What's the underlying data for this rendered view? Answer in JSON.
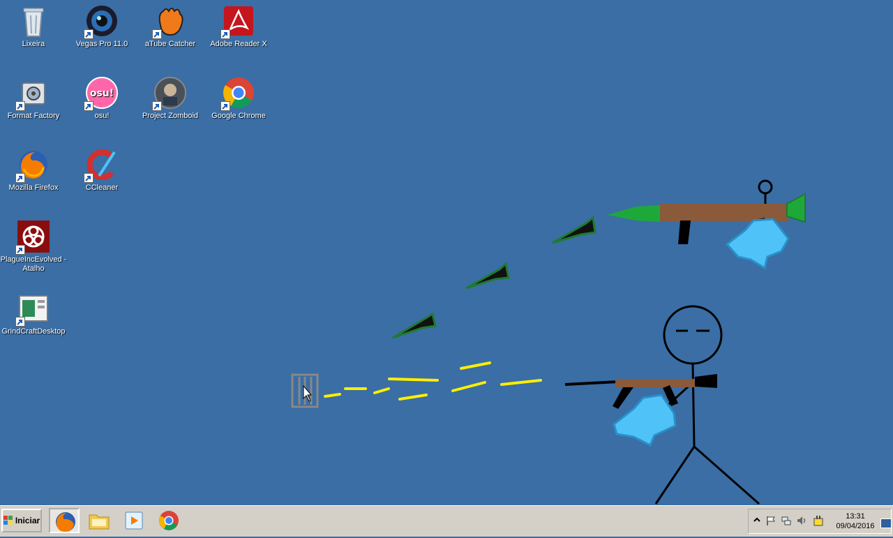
{
  "desktop": {
    "icons": [
      {
        "label": "Lixeira"
      },
      {
        "label": "Vegas Pro 11.0"
      },
      {
        "label": "aTube Catcher"
      },
      {
        "label": "Adobe Reader X"
      },
      {
        "label": "Format Factory"
      },
      {
        "label": "osu!"
      },
      {
        "label": "Project Zomboid"
      },
      {
        "label": "Google Chrome"
      },
      {
        "label": "Mozilla Firefox"
      },
      {
        "label": "CCleaner"
      },
      {
        "label": "PlagueIncEvolved - Atalho"
      },
      {
        "label": "GrindCraftDesktop"
      }
    ]
  },
  "taskbar": {
    "start_label": "Iniciar",
    "clock_time": "13:31",
    "clock_date": "09/04/2016"
  },
  "colors": {
    "desktop_bg": "#3a6ea5",
    "taskbar_bg": "#d4d0c8",
    "bullet_yellow": "#ffee00",
    "rocket_green": "#1fa83a",
    "gun_brown": "#8a5a3a",
    "glove_blue": "#4fc3f7"
  }
}
